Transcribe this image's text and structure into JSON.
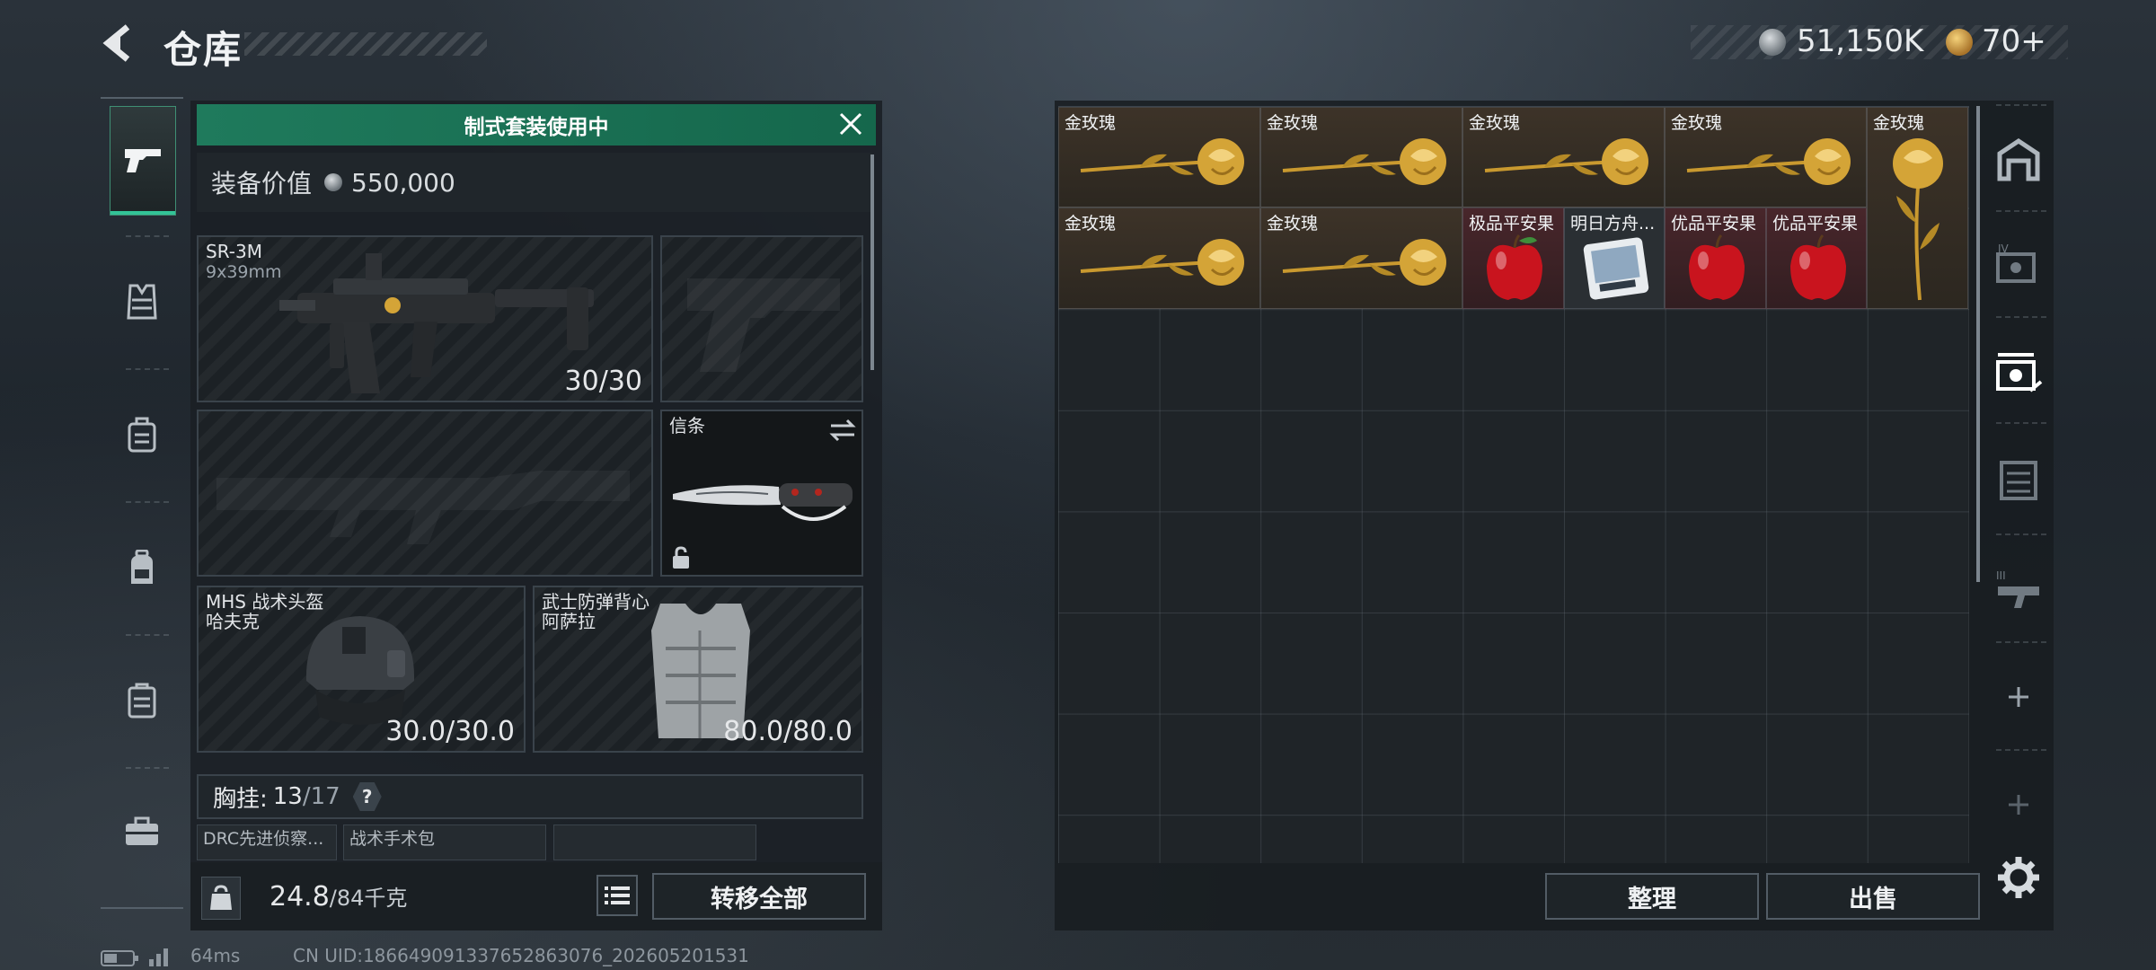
{
  "header": {
    "title": "仓库",
    "currency_silver": "51,150K",
    "currency_gold": "70+"
  },
  "left_nav": {
    "items": [
      "weapon-icon",
      "armor-icon",
      "rig-icon",
      "backpack-icon",
      "storage-case-icon",
      "toolbox-icon"
    ]
  },
  "equipment": {
    "kit_banner": "制式套装使用中",
    "value_label": "装备价值",
    "value": "550,000",
    "primary_weapon": {
      "name": "SR-3M",
      "caliber": "9x39mm",
      "ammo": "30/30"
    },
    "melee": {
      "name": "信条"
    },
    "helmet": {
      "name": "MHS 战术头盔",
      "sub": "哈夫克",
      "durability": "30.0/30.0"
    },
    "armor": {
      "name": "武士防弹背心",
      "sub": "阿萨拉",
      "durability": "80.0/80.0"
    },
    "chest_rig": {
      "label": "胸挂:",
      "used": "13",
      "total": "/17",
      "help": "?"
    },
    "mini_slots": [
      "DRC先进侦察...",
      "战术手术包",
      ""
    ],
    "weight": {
      "value": "24.8",
      "max": "/84千克"
    },
    "transfer_all": "转移全部"
  },
  "storage": {
    "items": [
      {
        "label": "金玫瑰",
        "kind": "rose"
      },
      {
        "label": "金玫瑰",
        "kind": "rose"
      },
      {
        "label": "金玫瑰",
        "kind": "rose"
      },
      {
        "label": "金玫瑰",
        "kind": "rose"
      },
      {
        "label": "金玫瑰",
        "kind": "rose-vertical"
      },
      {
        "label": "金玫瑰",
        "kind": "rose"
      },
      {
        "label": "金玫瑰",
        "kind": "rose"
      },
      {
        "label": "极品平安果",
        "kind": "apple"
      },
      {
        "label": "明日方舟...",
        "kind": "card"
      },
      {
        "label": "优品平安果",
        "kind": "apple"
      },
      {
        "label": "优品平安果",
        "kind": "apple"
      }
    ],
    "sort_button": "整理",
    "sell_button": "出售"
  },
  "status": {
    "ping": "64ms",
    "uid": "CN UID:186649091337652863076_202605201531"
  },
  "colors": {
    "accent_green": "#1f7a5c",
    "active_tab_line": "#33c397",
    "gold": "#d4a437",
    "apple_red": "#c9141e"
  }
}
